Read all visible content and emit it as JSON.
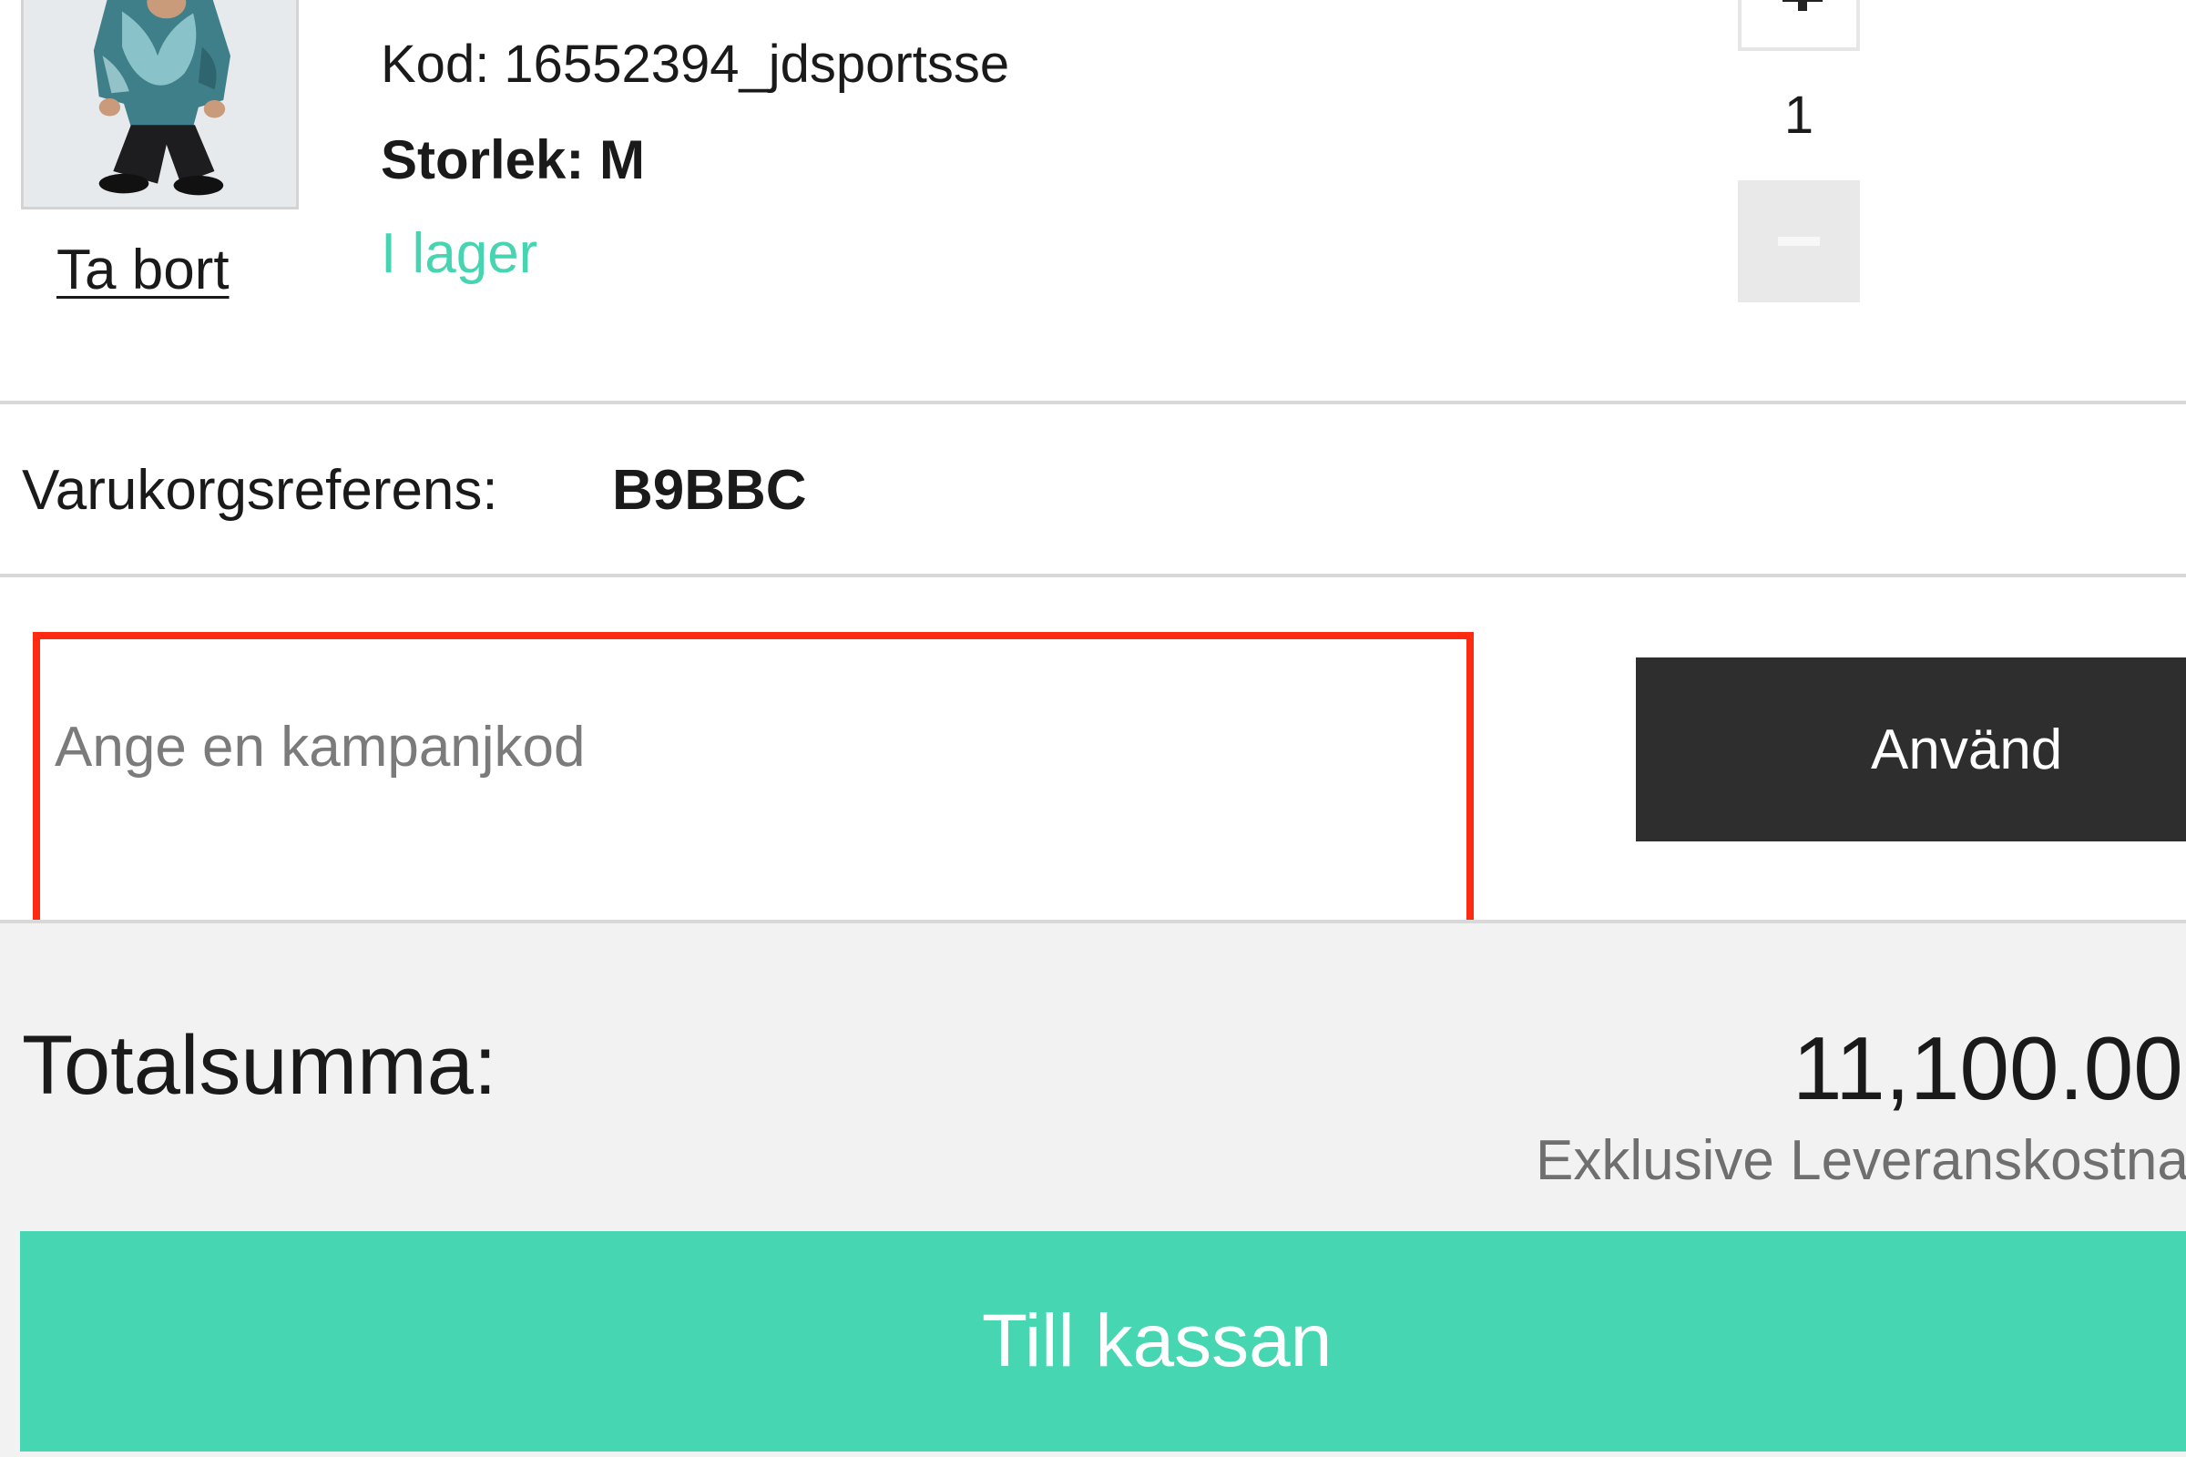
{
  "cart_item": {
    "image_alt": "Product photo",
    "remove_label": "Ta bort",
    "code_text": "Kod: 16552394_jdsportsse",
    "size_text": "Storlek: M",
    "stock_text": "I lager",
    "quantity": "1",
    "plus_icon": "plus-icon",
    "minus_icon": "minus-icon"
  },
  "cart_reference": {
    "label": "Varukorgsreferens:",
    "value": "B9BBC"
  },
  "promo": {
    "placeholder": "Ange en kampanjkod",
    "value": "",
    "apply_label": "Använd",
    "highlight_color": "#ff2a12"
  },
  "totals": {
    "label": "Totalsumma:",
    "amount": "11,100.00",
    "shipping_note": "Exklusive Leveranskostnad"
  },
  "checkout": {
    "label": "Till kassan"
  },
  "colors": {
    "accent": "#46d6b2",
    "in_stock": "#47d4b1",
    "dark_button": "#2e2e2e",
    "summary_bg": "#f2f2f2"
  }
}
